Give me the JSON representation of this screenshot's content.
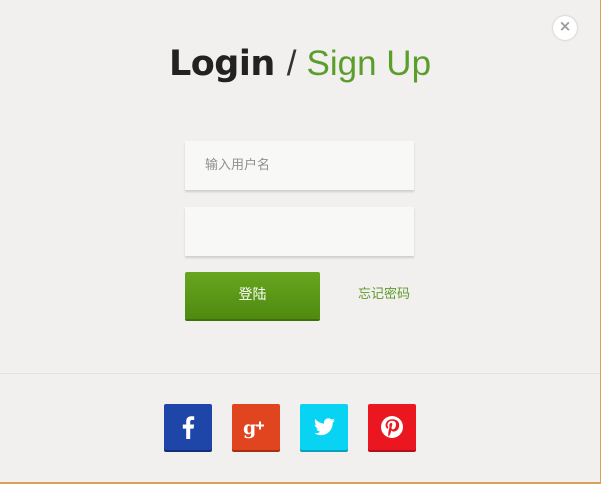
{
  "title": {
    "login": "Login",
    "separator": "/",
    "signup": "Sign Up"
  },
  "close": {
    "icon": "close-icon",
    "glyph": "×"
  },
  "form": {
    "username_placeholder": "输入用户名",
    "password_placeholder": "",
    "login_label": "登陆",
    "forgot_label": "忘记密码"
  },
  "social": [
    {
      "name": "facebook",
      "icon": "facebook-icon",
      "color": "#1e45a8"
    },
    {
      "name": "google-plus",
      "icon": "google-plus-icon",
      "color": "#e0451f"
    },
    {
      "name": "twitter",
      "icon": "twitter-icon",
      "color": "#08d3f2"
    },
    {
      "name": "pinterest",
      "icon": "pinterest-icon",
      "color": "#ea1620"
    }
  ],
  "colors": {
    "accent": "#5b9e2c",
    "button": "#5a9818",
    "modal_bg": "#f1f0ef",
    "page_bg": "#d9a15c"
  }
}
